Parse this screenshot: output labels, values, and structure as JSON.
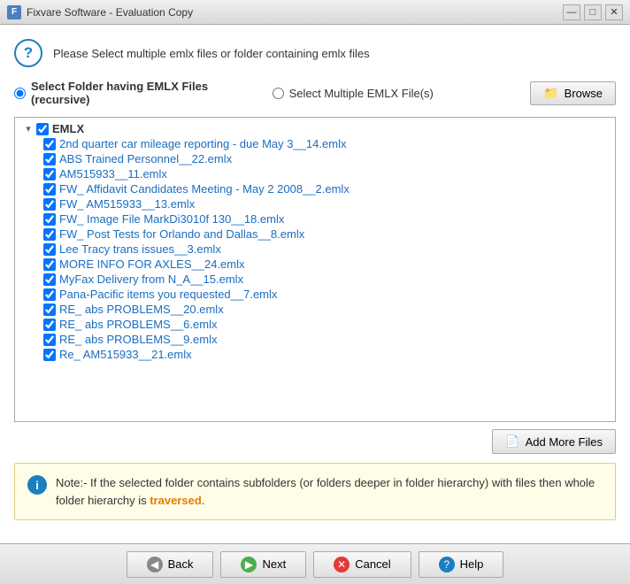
{
  "titleBar": {
    "icon": "F",
    "title": "Fixvare Software - Evaluation Copy",
    "minimizeBtn": "—",
    "maximizeBtn": "□",
    "closeBtn": "✕"
  },
  "instruction": {
    "text": "Please Select multiple emlx files or folder containing emlx files"
  },
  "radioOptions": {
    "option1": {
      "label": "Select Folder having EMLX Files (recursive)",
      "checked": true
    },
    "option2": {
      "label": "Select Multiple EMLX File(s)",
      "checked": false
    },
    "browseBtn": "Browse"
  },
  "fileTree": {
    "rootLabel": "EMLX",
    "files": [
      "2nd quarter car mileage reporting - due May 3__14.emlx",
      "ABS Trained Personnel__22.emlx",
      "AM515933__11.emlx",
      "FW_ Affidavit Candidates Meeting - May 2 2008__2.emlx",
      "FW_ AM515933__13.emlx",
      "FW_ Image File MarkDi3010f 130__18.emlx",
      "FW_ Post Tests for Orlando and Dallas__8.emlx",
      "Lee Tracy trans issues__3.emlx",
      "MORE INFO FOR AXLES__24.emlx",
      "MyFax Delivery from N_A__15.emlx",
      "Pana-Pacific items you requested__7.emlx",
      "RE_ abs PROBLEMS__20.emlx",
      "RE_ abs PROBLEMS__6.emlx",
      "RE_ abs PROBLEMS__9.emlx",
      "Re_ AM515933__21.emlx"
    ]
  },
  "addMoreFilesBtn": "Add More Files",
  "note": {
    "prefix": "Note:- If the selected folder contains subfolders (or folders deeper in folder hierarchy)",
    "suffix": " with files then whole folder hierarchy is ",
    "keyword": "traversed",
    "end": "."
  },
  "navBar": {
    "backBtn": "Back",
    "nextBtn": "Next",
    "cancelBtn": "Cancel",
    "helpBtn": "Help"
  }
}
